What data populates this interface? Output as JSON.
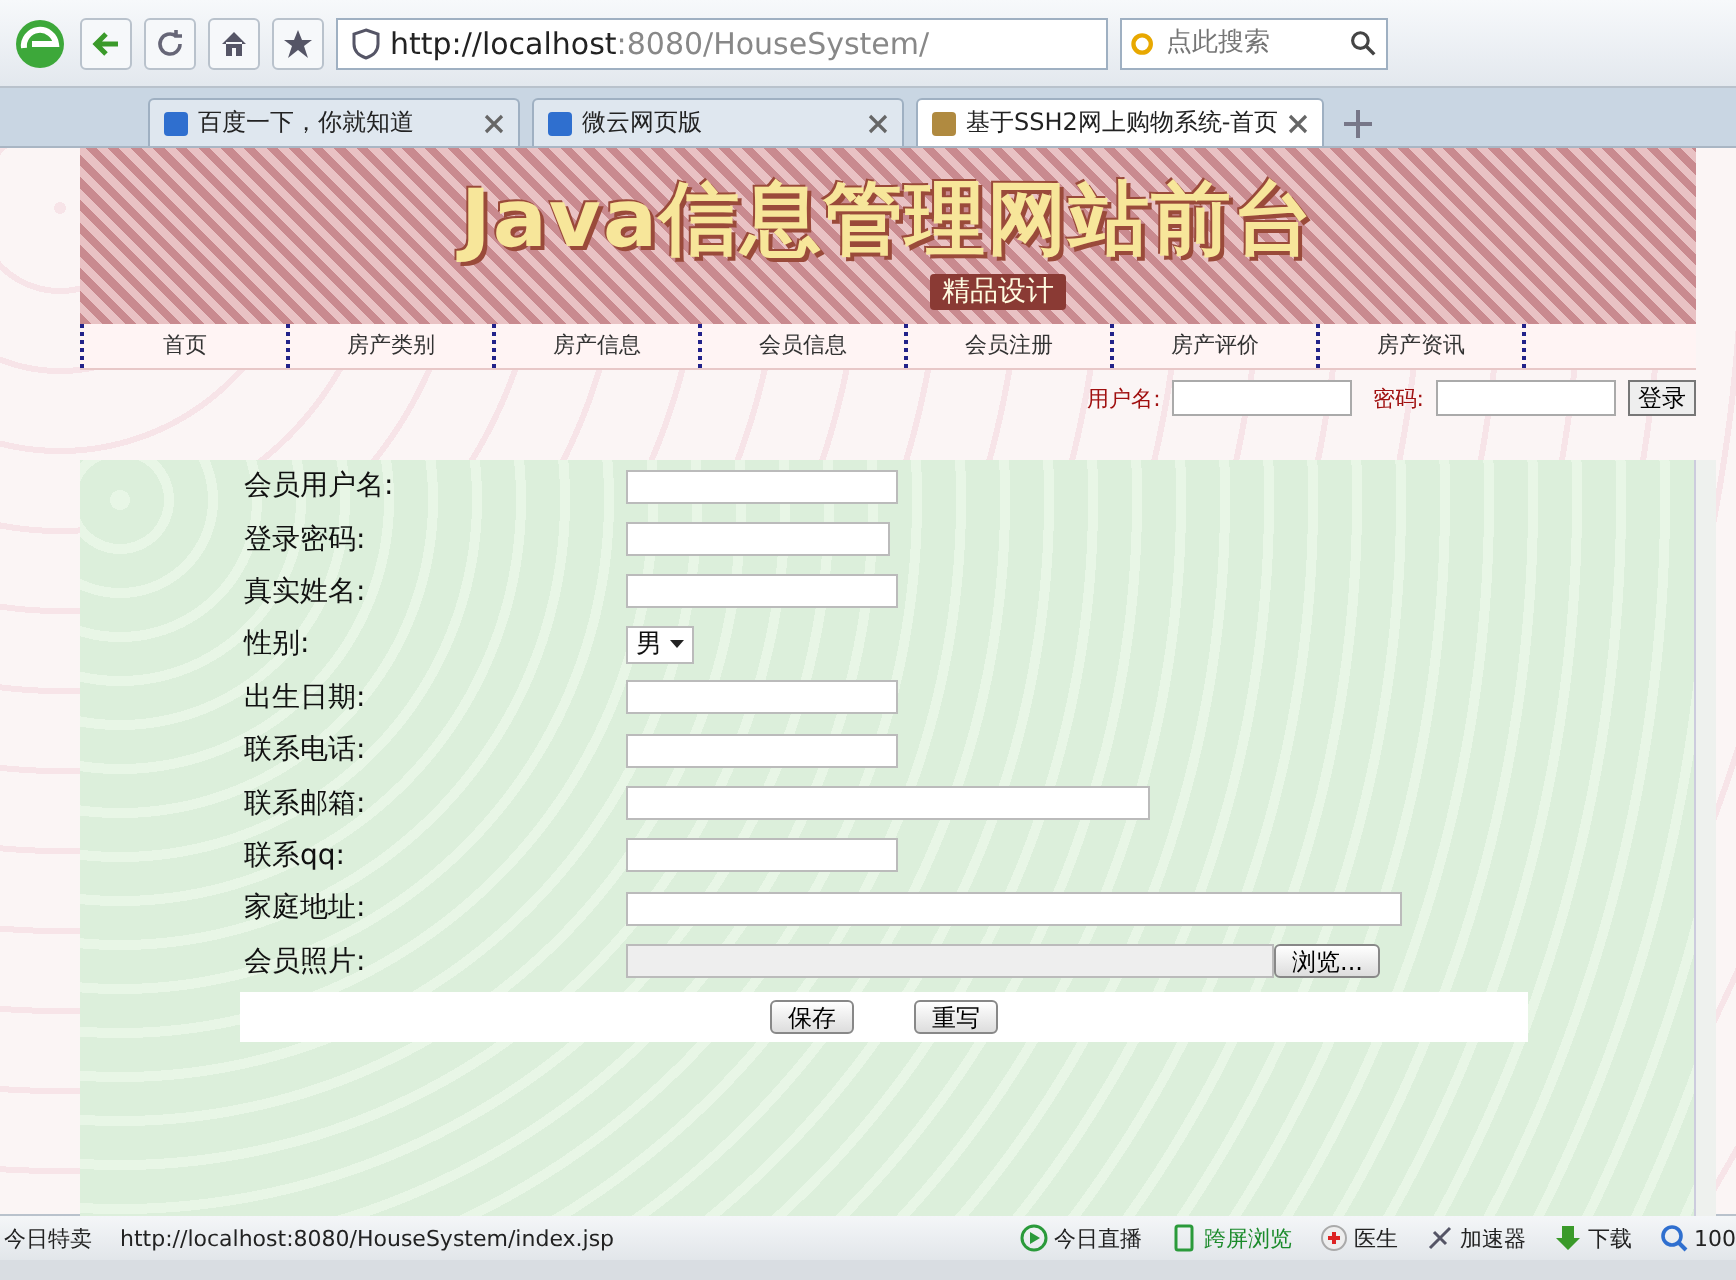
{
  "browser": {
    "url_host": "http://localhost",
    "url_rest": ":8080/HouseSystem/",
    "search_placeholder": "点此搜索",
    "tabs": [
      {
        "title": "百度一下，你就知道",
        "selected": false
      },
      {
        "title": "微云网页版",
        "selected": false
      },
      {
        "title": "基于SSH2网上购物系统-首页",
        "selected": true
      }
    ]
  },
  "banner": {
    "title": "Java信息管理网站前台",
    "subtitle": "精品设计"
  },
  "nav": [
    "首页",
    "房产类别",
    "房产信息",
    "会员信息",
    "会员注册",
    "房产评价",
    "房产资讯"
  ],
  "login": {
    "username_label": "用户名:",
    "password_label": "密码:",
    "button": "登录"
  },
  "form": {
    "fields": [
      {
        "label": "会员用户名:",
        "kind": "text"
      },
      {
        "label": "登录密码:",
        "kind": "password"
      },
      {
        "label": "真实姓名:",
        "kind": "text"
      },
      {
        "label": "性别:",
        "kind": "select",
        "value": "男"
      },
      {
        "label": "出生日期:",
        "kind": "text"
      },
      {
        "label": "联系电话:",
        "kind": "text"
      },
      {
        "label": "联系邮箱:",
        "kind": "email"
      },
      {
        "label": "联系qq:",
        "kind": "text"
      },
      {
        "label": "家庭地址:",
        "kind": "address"
      },
      {
        "label": "会员照片:",
        "kind": "file",
        "button": "浏览..."
      }
    ],
    "buttons": [
      "保存",
      "重写"
    ]
  },
  "status_bar": {
    "left": "今日特卖",
    "url": "http://localhost:8080/HouseSystem/index.jsp",
    "items": [
      "今日直播",
      "跨屏浏览",
      "医生",
      "加速器",
      "下载"
    ],
    "zoom": "100"
  }
}
